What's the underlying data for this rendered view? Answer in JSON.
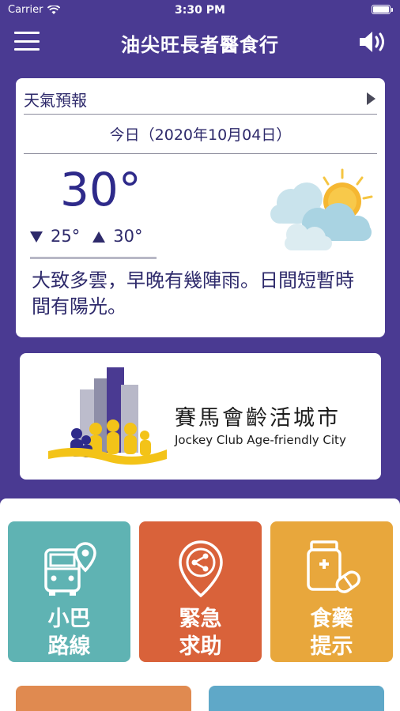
{
  "status_bar": {
    "carrier": "Carrier",
    "time": "3:30 PM"
  },
  "nav": {
    "title": "油尖旺長者醫食行"
  },
  "weather": {
    "header": "天氣預報",
    "date": "今日（2020年10月04日）",
    "temperature": "30°",
    "low": "25°",
    "high": "30°",
    "description": "大致多雲，早晚有幾陣雨。日間短暫時間有陽光。",
    "icon": "cloudy-sun-icon"
  },
  "banner": {
    "name_zh": "賽馬會齡活城市",
    "name_en": "Jockey Club Age-friendly City"
  },
  "tiles": [
    {
      "label": "小巴\n路線",
      "icon": "minibus-location-icon",
      "color": "#5fb3b3"
    },
    {
      "label": "緊急\n求助",
      "icon": "share-location-icon",
      "color": "#d9623a"
    },
    {
      "label": "食藥\n提示",
      "icon": "medicine-icon",
      "color": "#e8a73c"
    }
  ],
  "colors": {
    "primary": "#4a3a92",
    "text_dark": "#2e2a6b"
  }
}
